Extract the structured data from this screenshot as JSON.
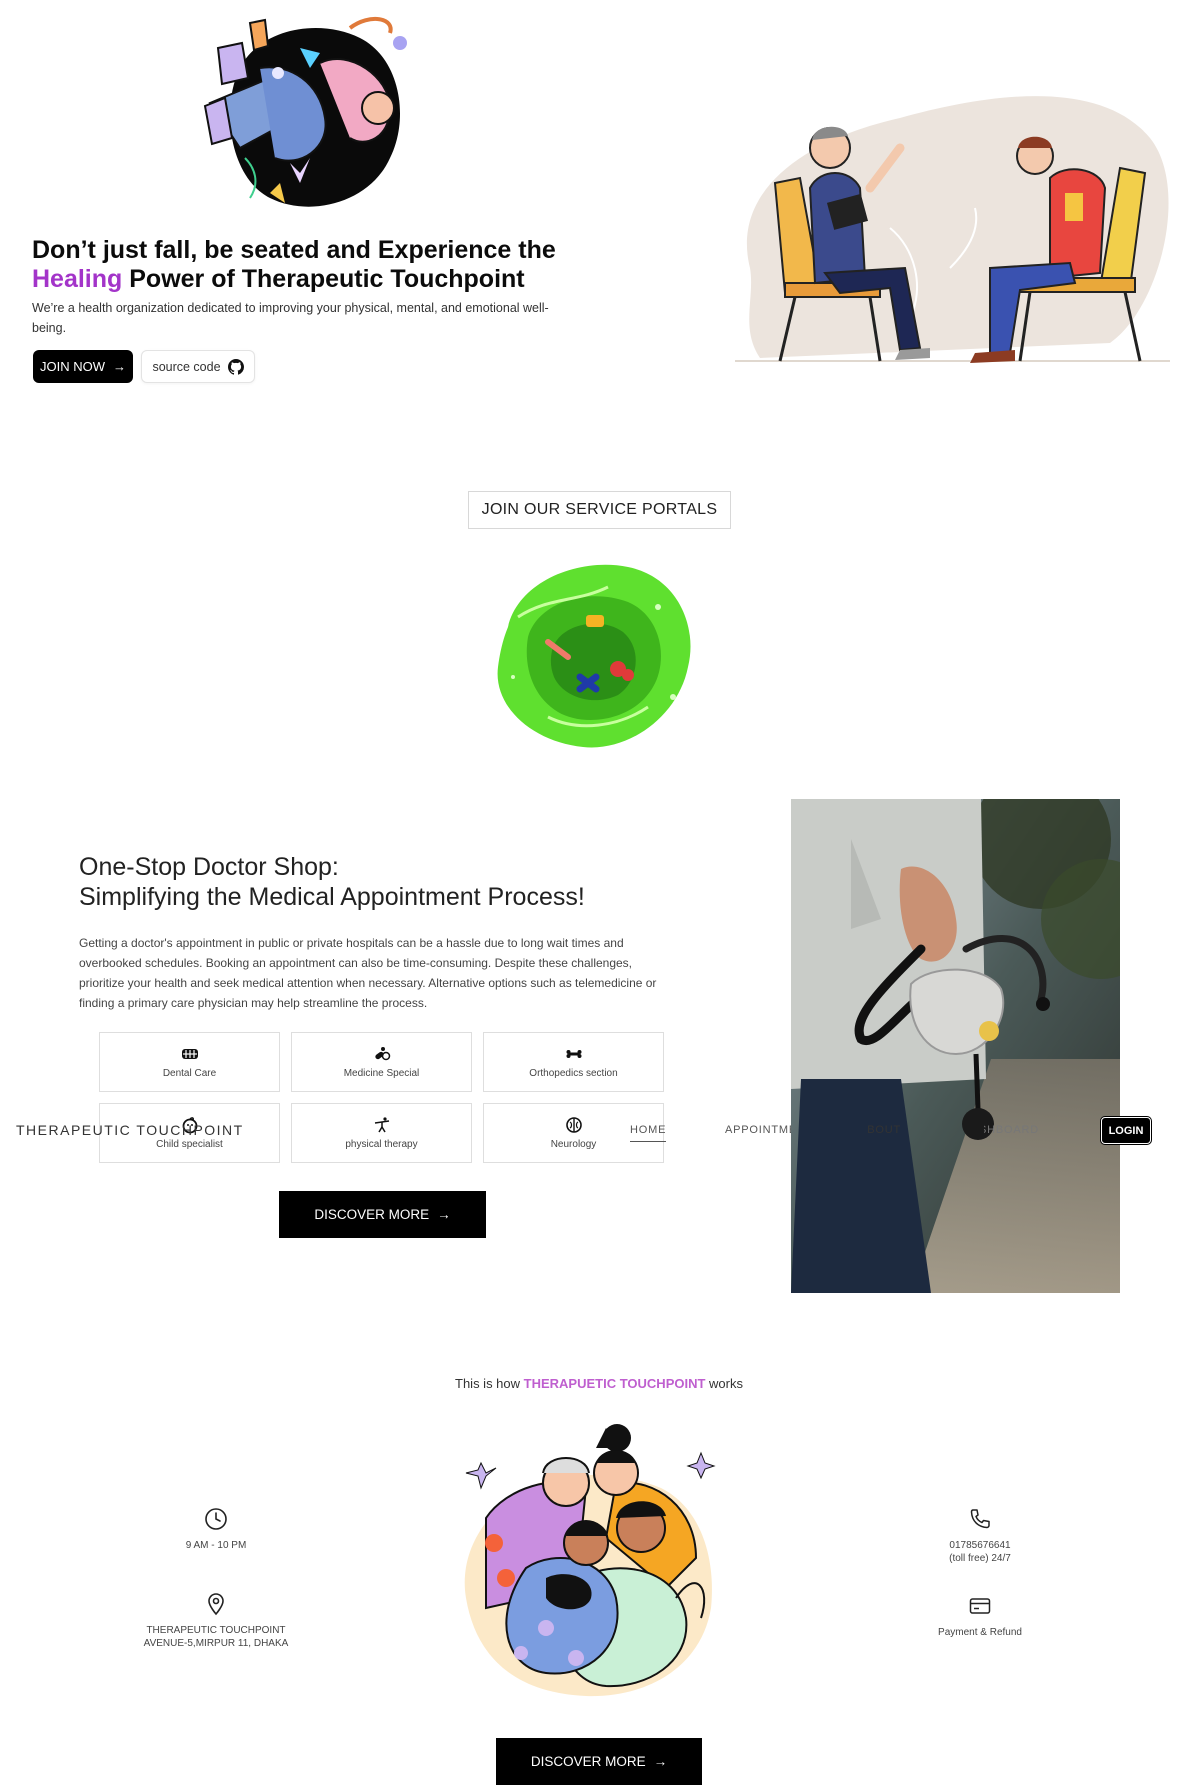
{
  "hero": {
    "title_part1": "Don’t just fall, be seated and Experience the",
    "title_accent": "Healing",
    "title_part2": " Power of Therapeutic Touchpoint",
    "description": "We’re a health organization dedicated to improving your physical, mental, and emotional well-being.",
    "join_label": "JOIN NOW",
    "source_label": "source code"
  },
  "portals": {
    "button_label": "JOIN OUR SERVICE PORTALS"
  },
  "onestop": {
    "title_line1": "One-Stop Doctor Shop:",
    "title_line2": "Simplifying the Medical Appointment Process!",
    "description": "Getting a doctor's appointment in public or private hospitals can be a hassle due to long wait times and overbooked schedules. Booking an appointment can also be time-consuming. Despite these challenges, prioritize your health and seek medical attention when necessary. Alternative options such as telemedicine or finding a primary care physician may help streamline the process.",
    "services": [
      {
        "label": "Dental Care",
        "icon": "teeth-icon"
      },
      {
        "label": "Medicine Special",
        "icon": "pills-icon"
      },
      {
        "label": "Orthopedics section",
        "icon": "bone-icon"
      },
      {
        "label": "Child specialist",
        "icon": "baby-icon"
      },
      {
        "label": "physical therapy",
        "icon": "stretch-icon"
      },
      {
        "label": "Neurology",
        "icon": "brain-icon"
      }
    ],
    "discover_label": "DISCOVER MORE"
  },
  "nav": {
    "brand": "THERAPEUTIC TOUCHPOINT",
    "home": "HOME",
    "appointment": "APPOINTMENT",
    "about": "ABOUT",
    "dashboard": "DASHBOARD",
    "login": "LOGIN"
  },
  "how": {
    "prefix": "This is how ",
    "brand": "THERAPUETIC TOUCHPOINT",
    "suffix": " works",
    "hours": "9 AM - 10 PM",
    "address_line1": "THERAPEUTIC TOUCHPOINT",
    "address_line2": "AVENUE-5,MIRPUR 11, DHAKA",
    "phone_line1": "01785676641",
    "phone_line2": "(toll free) 24/7",
    "payment": "Payment & Refund",
    "discover_label": "DISCOVER MORE"
  },
  "colors": {
    "accent_purple": "#a334c9",
    "brand_pink": "#bf5fcf",
    "button_black": "#000000",
    "portal_green": "#4cd82a"
  }
}
